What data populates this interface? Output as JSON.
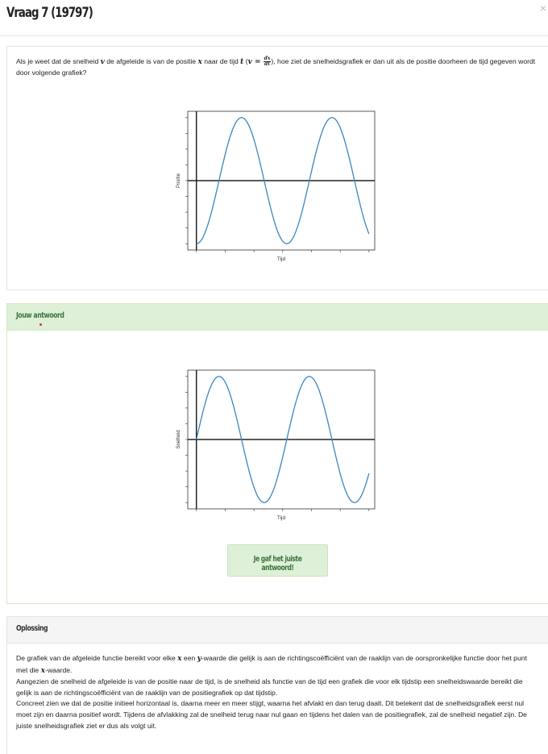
{
  "dialog": {
    "title": "Vraag 7 (19797)",
    "close_glyph": "×"
  },
  "question": {
    "text_part1": "Als je weet dat de snelheid ",
    "var_v": "v",
    "text_part2": " de afgeleide is van de positie ",
    "var_x": "x",
    "text_part3": " naar de tijd ",
    "var_t": "t",
    "text_part4": " (",
    "formula_lhs": "v",
    "formula_eq": " = ",
    "frac_num": "dx",
    "frac_den": "dt",
    "text_part5": "), hoe ziet de snelheidsgrafiek er dan uit als de positie doorheen de tijd gegeven wordt door volgende grafiek?"
  },
  "answer": {
    "heading": "Jouw antwoord",
    "feedback": "Je gaf het juiste antwoord!",
    "feedback_color": "#3c763d"
  },
  "solution": {
    "heading": "Oplossing",
    "p1_a": "De grafiek van de afgeleide functie bereikt voor elke ",
    "p1_x": "x",
    "p1_b": " een ",
    "p1_y": "y",
    "p1_c": "-waarde die gelijk is aan de richtingscoëfficiënt van de raaklijn van de oorspronkelijke functie door het punt met die ",
    "p1_x2": "x",
    "p1_d": "-waarde.",
    "p2": "Aangezien de snelheid de afgeleide is van de positie naar de tijd, is de snelheid als functie van de tijd een grafiek die voor elk tijdstip een snelheidswaarde bereikt die gelijk is aan de richtingscoëfficiënt van de raaklijn van de positiegrafiek op dat tijdstip.",
    "p3": "Concreet zien we dat de positie initieel horizontaal is, daarna meer en meer stijgt, waarna het afvlakt en dan terug daalt. Dit betekent dat de snelheidsgrafiek eerst nul moet zijn en daarna positief wordt. Tijdens de afvlakking zal de snelheid terug naar nul gaan en tijdens het dalen van de positiegrafiek, zal de snelheid negatief zijn. De juiste snelheidsgrafiek ziet er dus als volgt uit."
  },
  "chart_data": [
    {
      "type": "line",
      "function": "-cos(t)",
      "x": [
        0.0,
        0.5,
        1.0,
        1.5,
        2.0,
        2.5,
        3.0,
        3.5,
        4.0,
        4.5,
        5.0,
        5.5,
        6.0,
        6.5,
        7.0,
        7.5,
        8.0,
        8.5,
        9.0,
        9.5,
        10.0,
        10.5,
        11.0,
        11.5,
        12.0
      ],
      "y": [
        -1.0,
        -0.878,
        -0.54,
        -0.071,
        0.416,
        0.801,
        0.99,
        0.936,
        0.654,
        0.211,
        -0.284,
        -0.709,
        -0.96,
        -0.977,
        -0.754,
        -0.347,
        0.146,
        0.602,
        0.911,
        0.997,
        0.839,
        0.476,
        -0.004,
        -0.483,
        -0.844
      ],
      "xlim": [
        -0.6,
        12.4
      ],
      "ylim": [
        -1.1,
        1.1
      ],
      "xlabel": "Tijd",
      "ylabel": "Positie",
      "line_color": "#3b86be",
      "grid": false
    },
    {
      "type": "line",
      "function": "sin(t)",
      "x": [
        0.0,
        0.5,
        1.0,
        1.5,
        2.0,
        2.5,
        3.0,
        3.5,
        4.0,
        4.5,
        5.0,
        5.5,
        6.0,
        6.5,
        7.0,
        7.5,
        8.0,
        8.5,
        9.0,
        9.5,
        10.0,
        10.5,
        11.0,
        11.5,
        12.0
      ],
      "y": [
        0.0,
        0.479,
        0.841,
        0.997,
        0.909,
        0.598,
        0.141,
        -0.351,
        -0.757,
        -0.978,
        -0.959,
        -0.706,
        -0.279,
        0.215,
        0.657,
        0.938,
        0.989,
        0.798,
        0.412,
        -0.075,
        -0.544,
        -0.88,
        -1.0,
        -0.875,
        -0.537
      ],
      "xlim": [
        -0.6,
        12.4
      ],
      "ylim": [
        -1.1,
        1.1
      ],
      "xlabel": "Tijd",
      "ylabel": "Snelheid",
      "line_color": "#3b86be",
      "grid": false
    }
  ]
}
